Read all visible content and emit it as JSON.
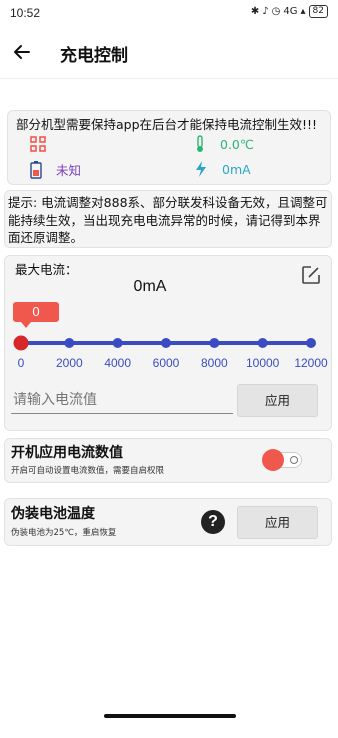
{
  "status_bar": {
    "time": "10:52",
    "network": "4G",
    "battery": "82"
  },
  "appbar": {
    "back_icon": "arrow-left-icon",
    "title": "充电控制"
  },
  "notice": {
    "text": "部分机型需要保持app在后台才能保持电流控制生效!!!",
    "temperature": "0.0℃",
    "status": "未知",
    "current": "0mA",
    "icons": [
      "grid-icon",
      "thermometer-icon",
      "battery-icon",
      "charge-bolt-icon"
    ]
  },
  "hint": {
    "text": "提示: 电流调整对888系、部分联发科设备无效，且调整可能持续生效，当出现充电电流异常的时候，请记得到本界面还原调整。"
  },
  "max_current": {
    "label": "最大电流：",
    "value": "0mA",
    "slider_value": "0",
    "slider": {
      "min": 0,
      "max": 12000,
      "step": 2000,
      "value": 0,
      "ticks": [
        "0",
        "2000",
        "4000",
        "6000",
        "8000",
        "10000",
        "12000"
      ]
    },
    "input_placeholder": "请输入电流值",
    "apply_label": "应用",
    "edit_icon": "edit-icon"
  },
  "boot_apply": {
    "title": "开机应用电流数值",
    "subtitle": "开启可自动设置电流数值，需要自启权限",
    "toggle_on": true
  },
  "fake_temp": {
    "title": "伪装电池温度",
    "subtitle": "伪装电池为25℃，重启恢复",
    "help_icon": "question-icon",
    "help_glyph": "?",
    "apply_label": "应用"
  },
  "colors": {
    "accent": "#f0584e",
    "slider": "#3b4cc0",
    "temp": "#2bb673",
    "status": "#7b3fbf",
    "current": "#2aa6c8"
  }
}
